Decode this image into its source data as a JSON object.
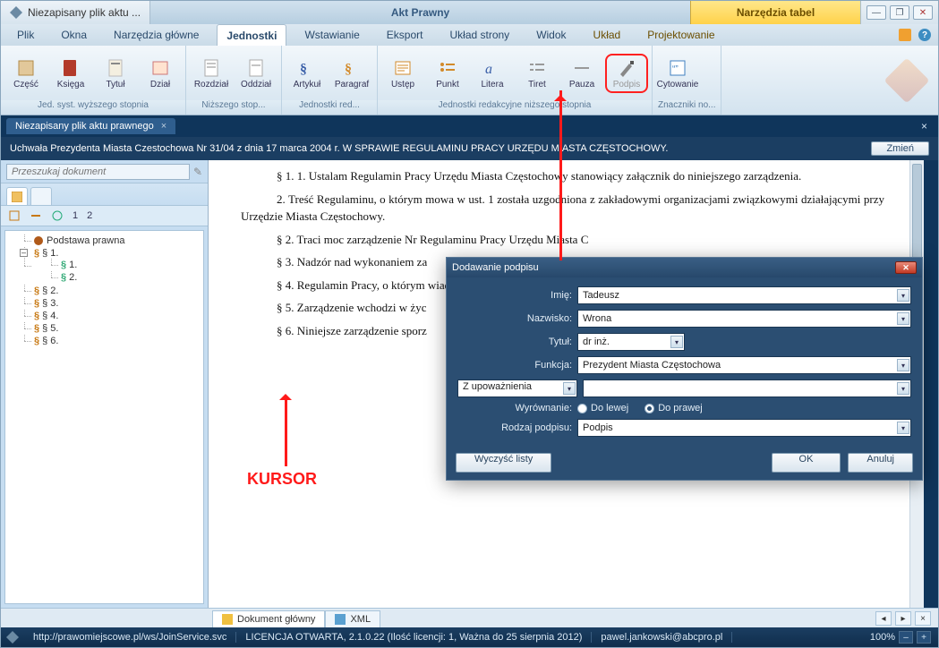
{
  "title_bar": {
    "left_tab": "Niezapisany plik aktu ...",
    "context_title": "Akt Prawny",
    "tools_title": "Narzędzia tabel"
  },
  "menu": {
    "tabs": [
      "Plik",
      "Okna",
      "Narzędzia główne",
      "Jednostki",
      "Wstawianie",
      "Eksport",
      "Układ strony",
      "Widok",
      "Układ",
      "Projektowanie"
    ],
    "active": "Jednostki"
  },
  "ribbon": {
    "groups": [
      {
        "label": "Jed. syst. wyższego stopnia",
        "items": [
          "Część",
          "Księga",
          "Tytuł",
          "Dział"
        ]
      },
      {
        "label": "Niższego stop...",
        "items": [
          "Rozdział",
          "Oddział"
        ]
      },
      {
        "label": "Jednostki red...",
        "items": [
          "Artykuł",
          "Paragraf"
        ]
      },
      {
        "label": "Jednostki redakcyjne niższego stopnia",
        "items": [
          "Ustęp",
          "Punkt",
          "Litera",
          "Tiret",
          "Pauza",
          "Podpis"
        ]
      },
      {
        "label": "Znaczniki no...",
        "items": [
          "Cytowanie"
        ]
      }
    ],
    "highlighted": "Podpis"
  },
  "doc_tab": "Niezapisany plik aktu prawnego",
  "banner": {
    "title": "Uchwała Prezydenta Miasta Czestochowa Nr 31/04 z dnia 17 marca 2004 r. W SPRAWIE REGULAMINU PRACY URZĘDU MIASTA CZĘSTOCHOWY.",
    "button": "Zmień"
  },
  "search": {
    "placeholder": "Przeszukaj dokument"
  },
  "toolrow": {
    "n1": "1",
    "n2": "2"
  },
  "tree": {
    "root": "Podstawa prawna",
    "sec1": "§ 1.",
    "sec1_1": "1.",
    "sec1_2": "2.",
    "sec2": "§ 2.",
    "sec3": "§ 3.",
    "sec4": "§ 4.",
    "sec5": "§ 5.",
    "sec6": "§ 6."
  },
  "document": {
    "p1": "§ 1. 1. Ustalam Regulamin Pracy Urzędu Miasta Częstochowy stanowiący załącznik do niniejszego zarządzenia.",
    "p2": "2. Treść Regulaminu, o którym mowa w ust. 1 została uzgodniona z zakładowymi organizacjami związkowymi działającymi przy Urzędzie Miasta Częstochowy.",
    "p3": "§ 2. Traci moc zarządzenie Nr                                                                                                           Regulaminu Pracy Urzędu Miasta C",
    "p4": "§ 3. Nadzór nad wykonaniem za",
    "p5": "§ 4. Regulamin Pracy, o którym                                                                                       wiadomości pracownikom w sieci I",
    "p6": "§ 5. Zarządzenie wchodzi w życ",
    "p7": "§ 6. Niniejsze zarządzenie sporz"
  },
  "annotation": {
    "kursor": "KURSOR"
  },
  "dialog": {
    "title": "Dodawanie podpisu",
    "labels": {
      "imie": "Imię:",
      "nazwisko": "Nazwisko:",
      "tytul": "Tytuł:",
      "funkcja": "Funkcja:",
      "zup": "Z upoważnienia",
      "wyr": "Wyrównanie:",
      "rodzaj": "Rodzaj podpisu:"
    },
    "values": {
      "imie": "Tadeusz",
      "nazwisko": "Wrona",
      "tytul": "dr inż.",
      "funkcja": "Prezydent Miasta Częstochowa",
      "extra": "",
      "rodzaj": "Podpis"
    },
    "radios": {
      "left": "Do lewej",
      "right": "Do prawej"
    },
    "buttons": {
      "clear": "Wyczyść listy",
      "ok": "OK",
      "cancel": "Anuluj"
    }
  },
  "footer_tabs": {
    "main": "Dokument główny",
    "xml": "XML"
  },
  "status": {
    "url": "http://prawomiejscowe.pl/ws/JoinService.svc",
    "license": "LICENCJA OTWARTA, 2.1.0.22 (Ilość licencji: 1, Ważna do 25 sierpnia 2012)",
    "user": "pawel.jankowski@abcpro.pl",
    "zoom": "100%"
  }
}
